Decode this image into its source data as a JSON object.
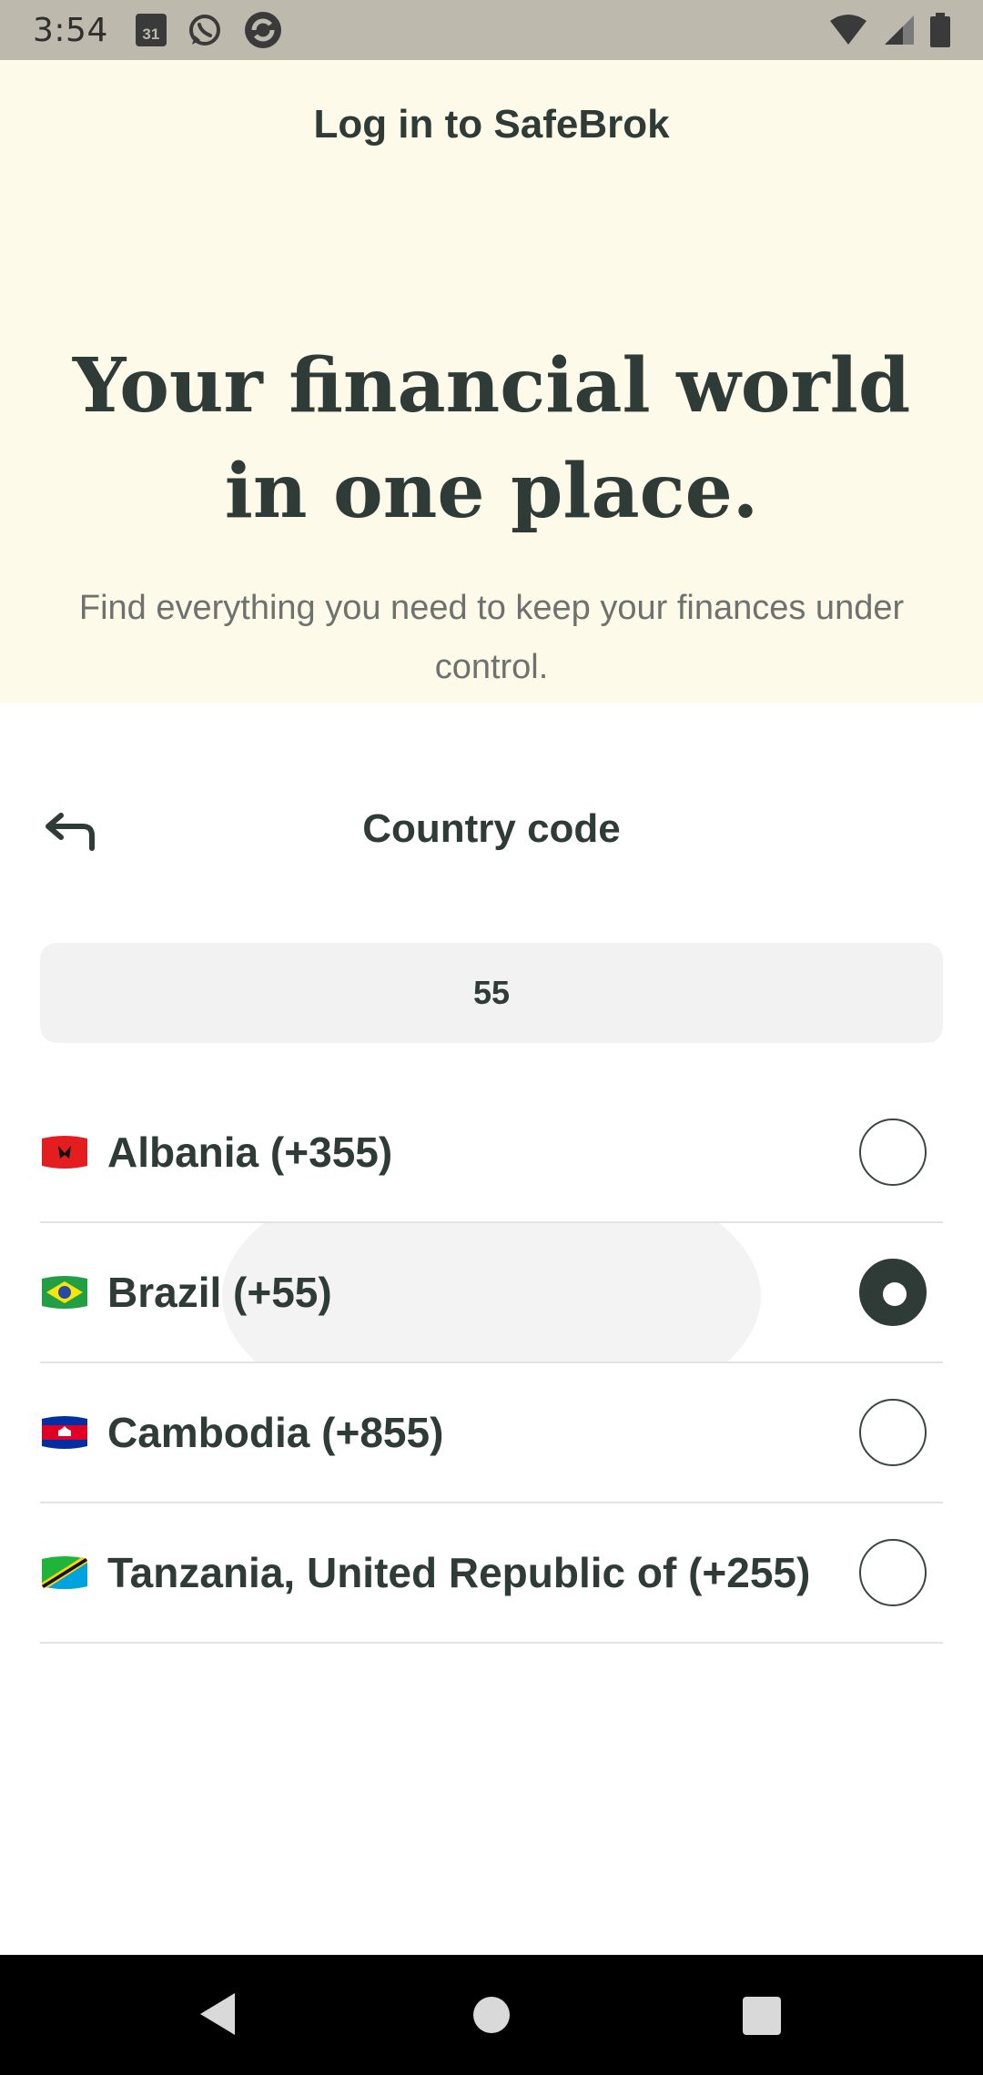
{
  "status_bar": {
    "time": "3:54",
    "calendar_day": "31",
    "icons_left": [
      "calendar-icon",
      "whatsapp-icon",
      "sync-app-icon"
    ],
    "icons_right": [
      "wifi-icon",
      "cell-signal-icon",
      "battery-icon"
    ]
  },
  "header": {
    "login_title": "Log in to SafeBrok",
    "hero_line1": "Your financial world",
    "hero_line2": "in one place.",
    "subtitle": "Find everything you need to keep your finances under control."
  },
  "sheet": {
    "title": "Country code",
    "back_icon": "back-arrow-icon",
    "search_value": "55"
  },
  "countries": [
    {
      "label": "Albania (+355)",
      "flag": "albania-flag-icon",
      "selected": false
    },
    {
      "label": "Brazil (+55)",
      "flag": "brazil-flag-icon",
      "selected": true
    },
    {
      "label": "Cambodia (+855)",
      "flag": "cambodia-flag-icon",
      "selected": false
    },
    {
      "label": "Tanzania, United Republic of (+255)",
      "flag": "tanzania-flag-icon",
      "selected": false
    }
  ],
  "colors": {
    "text_primary": "#2e3b36",
    "hero_background": "#fefae9",
    "input_background": "#f1f2f1",
    "status_bar": "#bdb9ad"
  }
}
